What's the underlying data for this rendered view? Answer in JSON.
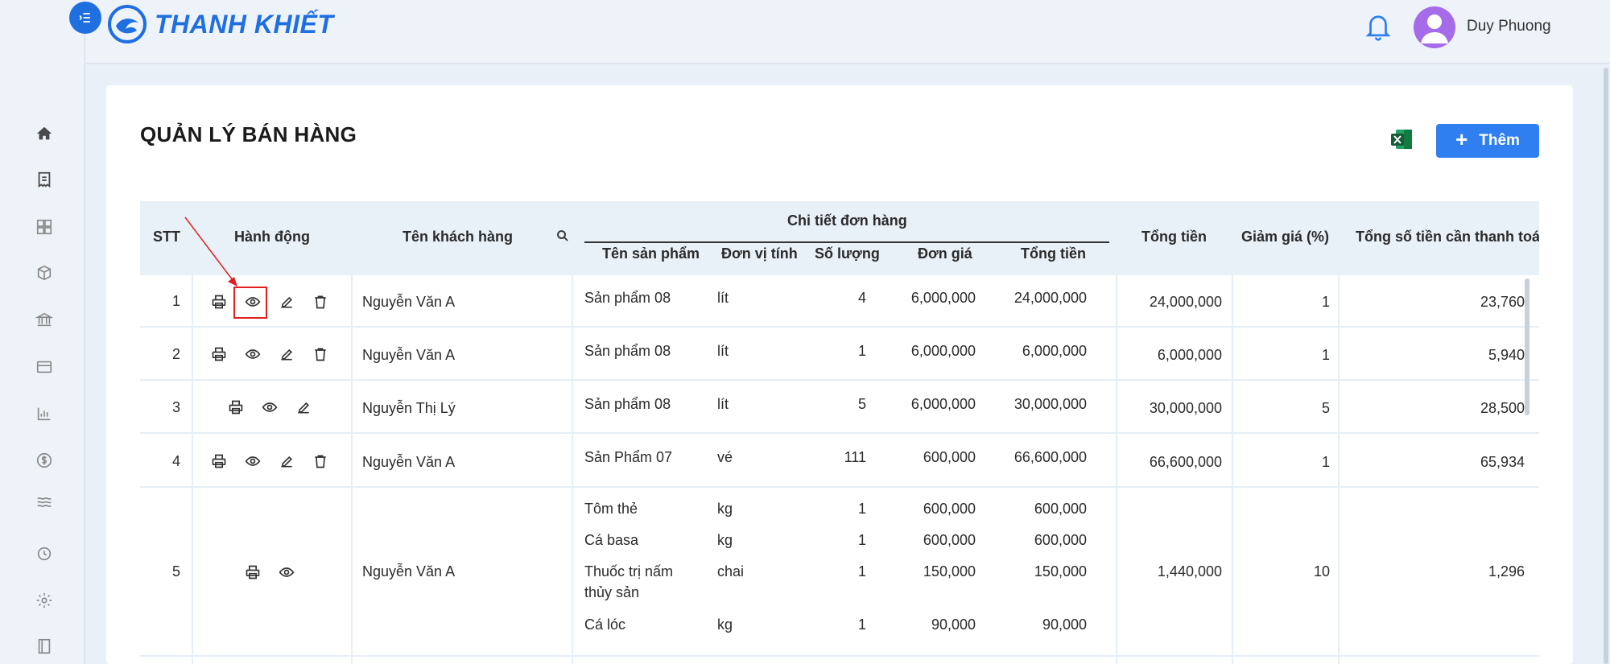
{
  "app": {
    "logo_text": "THANH KHIẾT"
  },
  "user": {
    "name": "Duy Phuong"
  },
  "sidebar": {
    "icons": [
      "home-icon",
      "invoice-icon",
      "grid-icon",
      "package-icon",
      "bank-icon",
      "wallet-icon",
      "bar-chart-icon",
      "dollar-icon",
      "water-icon",
      "history-icon",
      "settings-icon",
      "book-icon"
    ]
  },
  "page": {
    "title": "QUẢN LÝ BÁN HÀNG",
    "add_label": "Thêm"
  },
  "table": {
    "headers": {
      "stt": "STT",
      "actions": "Hành động",
      "customer": "Tên khách hàng",
      "order_detail": "Chi tiết đơn hàng",
      "product": "Tên sản phẩm",
      "unit": "Đơn vị tính",
      "qty": "Số lượng",
      "price": "Đơn giá",
      "line_total": "Tổng tiền",
      "total": "Tổng tiền",
      "discount": "Giảm giá (%)",
      "payable": "Tổng số tiền cần thanh toán"
    },
    "rows": [
      {
        "stt": "1",
        "customer": "Nguyễn Văn A",
        "total": "24,000,000",
        "discount": "1",
        "payable": "23,760",
        "items": [
          {
            "product": "Sản phẩm 08",
            "unit": "lít",
            "qty": "4",
            "price": "6,000,000",
            "line_total": "24,000,000"
          }
        ]
      },
      {
        "stt": "2",
        "customer": "Nguyễn Văn A",
        "total": "6,000,000",
        "discount": "1",
        "payable": "5,940",
        "items": [
          {
            "product": "Sản phẩm 08",
            "unit": "lít",
            "qty": "1",
            "price": "6,000,000",
            "line_total": "6,000,000"
          }
        ]
      },
      {
        "stt": "3",
        "customer": "Nguyễn Thị Lý",
        "total": "30,000,000",
        "discount": "5",
        "payable": "28,500",
        "items": [
          {
            "product": "Sản phẩm 08",
            "unit": "lít",
            "qty": "5",
            "price": "6,000,000",
            "line_total": "30,000,000"
          }
        ]
      },
      {
        "stt": "4",
        "customer": "Nguyễn Văn A",
        "total": "66,600,000",
        "discount": "1",
        "payable": "65,934",
        "items": [
          {
            "product": "Sản Phẩm 07",
            "unit": "vé",
            "qty": "111",
            "price": "600,000",
            "line_total": "66,600,000"
          }
        ]
      },
      {
        "stt": "5",
        "customer": "Nguyễn Văn A",
        "total": "1,440,000",
        "discount": "10",
        "payable": "1,296",
        "items": [
          {
            "product": "Tôm thẻ",
            "unit": "kg",
            "qty": "1",
            "price": "600,000",
            "line_total": "600,000"
          },
          {
            "product": "Cá basa",
            "unit": "kg",
            "qty": "1",
            "price": "600,000",
            "line_total": "600,000"
          },
          {
            "product": "Thuốc trị nấm",
            "product_line2": "thủy sản",
            "unit": "chai",
            "qty": "1",
            "price": "150,000",
            "line_total": "150,000"
          },
          {
            "product": "Cá lóc",
            "unit": "kg",
            "qty": "1",
            "price": "90,000",
            "line_total": "90,000"
          }
        ]
      }
    ]
  }
}
